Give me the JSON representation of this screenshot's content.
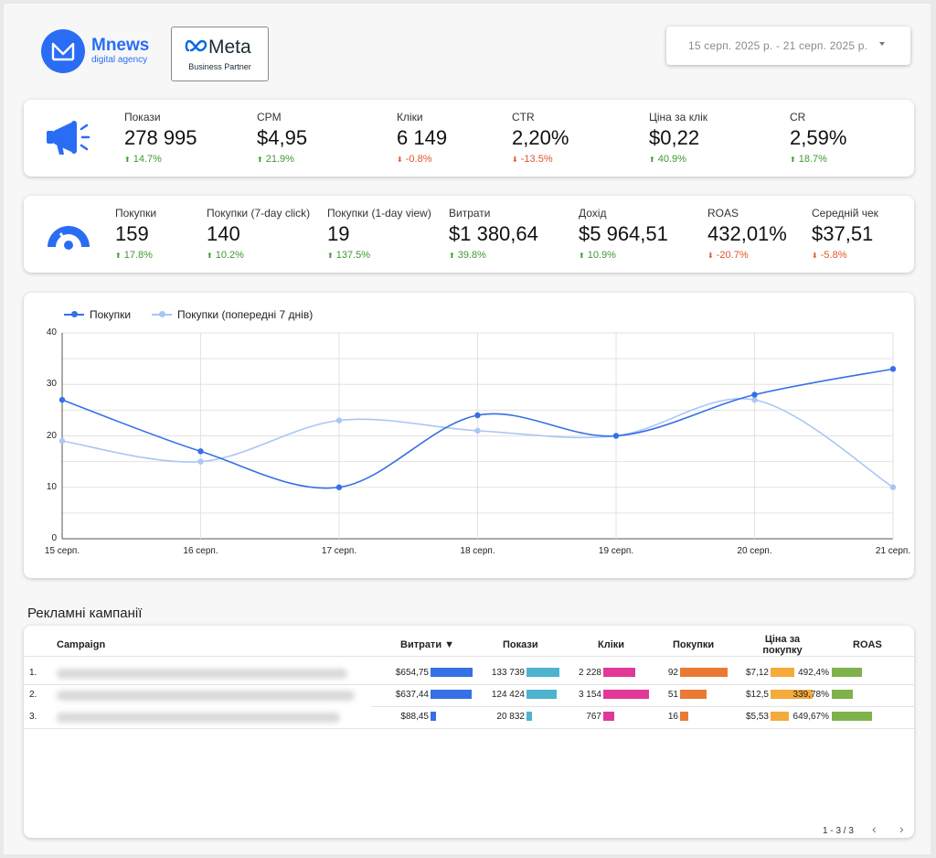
{
  "header": {
    "logo_name": "Mnews",
    "logo_sub": "digital agency",
    "meta_name": "Meta",
    "meta_sub": "Business Partner",
    "date_range": "15 серп. 2025 р. - 21 серп. 2025 р."
  },
  "kpis_top": [
    {
      "label": "Покази",
      "value": "278 995",
      "change": "14.7%",
      "dir": "up"
    },
    {
      "label": "CPM",
      "value": "$4,95",
      "change": "21.9%",
      "dir": "up"
    },
    {
      "label": "Кліки",
      "value": "6 149",
      "change": "-0.8%",
      "dir": "down"
    },
    {
      "label": "CTR",
      "value": "2,20%",
      "change": "-13.5%",
      "dir": "down"
    },
    {
      "label": "Ціна за клік",
      "value": "$0,22",
      "change": "40.9%",
      "dir": "up"
    },
    {
      "label": "CR",
      "value": "2,59%",
      "change": "18.7%",
      "dir": "up"
    }
  ],
  "kpis_bottom": [
    {
      "label": "Покупки",
      "value": "159",
      "change": "17.8%",
      "dir": "up"
    },
    {
      "label": "Покупки (7-day click)",
      "value": "140",
      "change": "10.2%",
      "dir": "up"
    },
    {
      "label": "Покупки (1-day view)",
      "value": "19",
      "change": "137.5%",
      "dir": "up"
    },
    {
      "label": "Витрати",
      "value": "$1 380,64",
      "change": "39.8%",
      "dir": "up"
    },
    {
      "label": "Дохід",
      "value": "$5 964,51",
      "change": "10.9%",
      "dir": "up"
    },
    {
      "label": "ROAS",
      "value": "432,01%",
      "change": "-20.7%",
      "dir": "down"
    },
    {
      "label": "Середній чек",
      "value": "$37,51",
      "change": "-5.8%",
      "dir": "down"
    }
  ],
  "chart_data": {
    "type": "line",
    "categories": [
      "15 серп.",
      "16 серп.",
      "17 серп.",
      "18 серп.",
      "19 серп.",
      "20 серп.",
      "21 серп."
    ],
    "series": [
      {
        "name": "Покупки",
        "values": [
          27,
          17,
          10,
          24,
          20,
          28,
          33
        ],
        "color": "#3570e6"
      },
      {
        "name": "Покупки (попередні 7 днів)",
        "values": [
          19,
          15,
          23,
          21,
          20,
          27,
          10
        ],
        "color": "#a9c6f5"
      }
    ],
    "yticks": [
      0,
      10,
      20,
      30,
      40
    ],
    "ylim": [
      0,
      40
    ],
    "grid": true,
    "legend": "top-left"
  },
  "table": {
    "title": "Рекламні кампанії",
    "columns": [
      "Campaign",
      "Витрати ▼",
      "Покази",
      "Кліки",
      "Покупки",
      "Ціна за покупку",
      "ROAS"
    ],
    "colors": [
      "#3570e6",
      "#4db3cf",
      "#e0399a",
      "#ea7a33",
      "#f5aa3c",
      "#7fb24a"
    ],
    "rows": [
      {
        "n": "1.",
        "spend": "$654,75",
        "spend_v": 654.75,
        "impr": "133 739",
        "impr_v": 133739,
        "clicks": "2 228",
        "clicks_v": 2228,
        "purch": "92",
        "purch_v": 92,
        "cpp": "$7,12",
        "cpp_v": 7.12,
        "roas": "492,4%",
        "roas_v": 492.4
      },
      {
        "n": "2.",
        "spend": "$637,44",
        "spend_v": 637.44,
        "impr": "124 424",
        "impr_v": 124424,
        "clicks": "3 154",
        "clicks_v": 3154,
        "purch": "51",
        "purch_v": 51,
        "cpp": "$12,5",
        "cpp_v": 12.5,
        "roas": "339,78%",
        "roas_v": 339.78
      },
      {
        "n": "3.",
        "spend": "$88,45",
        "spend_v": 88.45,
        "impr": "20 832",
        "impr_v": 20832,
        "clicks": "767",
        "clicks_v": 767,
        "purch": "16",
        "purch_v": 16,
        "cpp": "$5,53",
        "cpp_v": 5.53,
        "roas": "649,67%",
        "roas_v": 649.67
      }
    ],
    "pager": "1 - 3 / 3"
  }
}
